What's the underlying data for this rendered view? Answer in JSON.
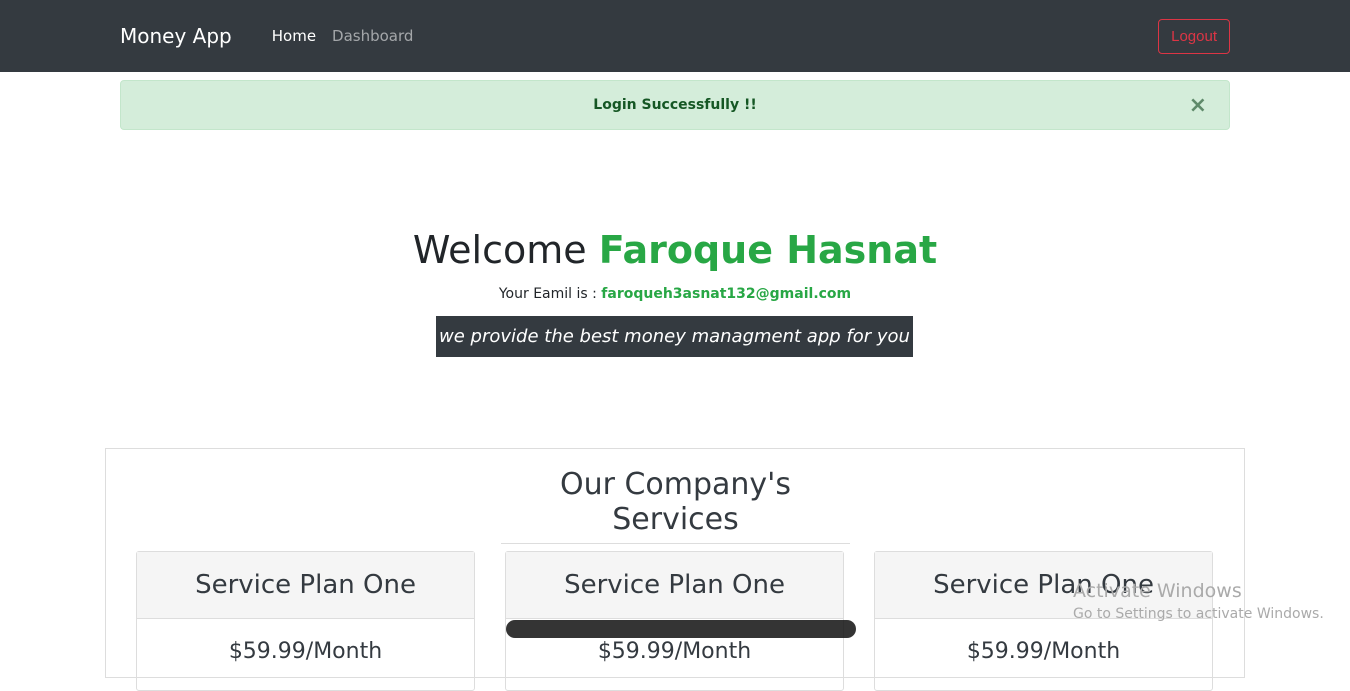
{
  "nav": {
    "brand": "Money App",
    "home": "Home",
    "dashboard": "Dashboard",
    "logout": "Logout"
  },
  "alert": {
    "message": "Login Successfully !!",
    "close": "×"
  },
  "hero": {
    "welcome": "Welcome",
    "name": "Faroque Hasnat",
    "email_label": "Your Eamil is :",
    "email": "faroqueh3asnat132@gmail.com",
    "tagline": "we provide the best money managment app for you"
  },
  "services": {
    "title": "Our Company's Services",
    "plans": [
      {
        "name": "Service Plan One",
        "price": "$59.99/Month"
      },
      {
        "name": "Service Plan One",
        "price": "$59.99/Month"
      },
      {
        "name": "Service Plan One",
        "price": "$59.99/Month"
      }
    ]
  },
  "watermark": {
    "title": "Activate Windows",
    "subtitle": "Go to Settings to activate Windows."
  }
}
